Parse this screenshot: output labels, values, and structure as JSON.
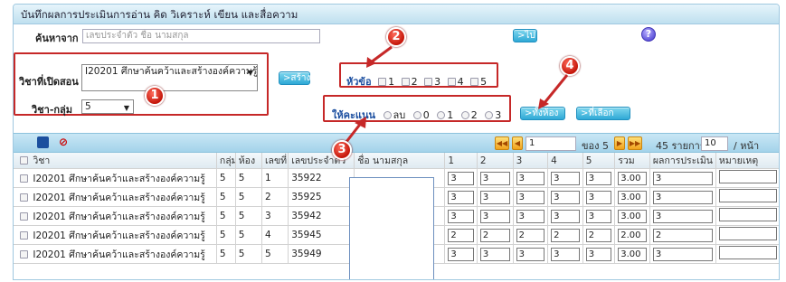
{
  "panel_title": "บันทึกผลการประเมินการอ่าน คิด วิเคราะห์ เขียน และสื่อความ",
  "search": {
    "label": "ค้นหาจาก",
    "placeholder": "เลขประจำตัว ชื่อ นามสกุล",
    "go_button": "ไป"
  },
  "subject": {
    "label": "วิชาที่เปิดสอน",
    "value": "I20201 ศึกษาค้นคว้าและสร้างองค์ความรู้"
  },
  "class_group": {
    "label": "วิชา-กลุ่ม",
    "value": "5"
  },
  "create_button": "สร้าง",
  "topics": {
    "label": "หัวข้อ",
    "options": [
      "1",
      "2",
      "3",
      "4",
      "5"
    ]
  },
  "scoring": {
    "label": "ให้คะแนน",
    "options": [
      "ลบ",
      "0",
      "1",
      "2",
      "3"
    ]
  },
  "room_button": "ทั้งห้อง",
  "selected_button": "ที่เลือก",
  "badges": {
    "b1": "1",
    "b2": "2",
    "b3": "3",
    "b4": "4"
  },
  "help_label": "?",
  "pager": {
    "page": "1",
    "of_label": "ของ 5",
    "total_label": "45 รายการ",
    "per_page": "10",
    "per_page_suffix": "/ หน้า"
  },
  "table": {
    "headers": [
      "วิชา",
      "กลุ่ม",
      "ห้อง",
      "เลขที่",
      "เลขประจำตัว",
      "ชื่อ นามสกุล",
      "1",
      "2",
      "3",
      "4",
      "5",
      "รวม",
      "ผลการประเมิน",
      "หมายเหตุ"
    ],
    "rows": [
      {
        "subject": "I20201 ศึกษาค้นคว้าและสร้างองค์ความรู้",
        "group": "5",
        "room": "5",
        "no": "1",
        "id": "35922",
        "s": [
          "3",
          "3",
          "3",
          "3",
          "3"
        ],
        "total": "3.00",
        "result": "3"
      },
      {
        "subject": "I20201 ศึกษาค้นคว้าและสร้างองค์ความรู้",
        "group": "5",
        "room": "5",
        "no": "2",
        "id": "35925",
        "s": [
          "3",
          "3",
          "3",
          "3",
          "3"
        ],
        "total": "3.00",
        "result": "3"
      },
      {
        "subject": "I20201 ศึกษาค้นคว้าและสร้างองค์ความรู้",
        "group": "5",
        "room": "5",
        "no": "3",
        "id": "35942",
        "s": [
          "3",
          "3",
          "3",
          "3",
          "3"
        ],
        "total": "3.00",
        "result": "3"
      },
      {
        "subject": "I20201 ศึกษาค้นคว้าและสร้างองค์ความรู้",
        "group": "5",
        "room": "5",
        "no": "4",
        "id": "35945",
        "s": [
          "2",
          "2",
          "2",
          "2",
          "2"
        ],
        "total": "2.00",
        "result": "2"
      },
      {
        "subject": "I20201 ศึกษาค้นคว้าและสร้างองค์ความรู้",
        "group": "5",
        "room": "5",
        "no": "5",
        "id": "35949",
        "s": [
          "3",
          "3",
          "3",
          "3",
          "3"
        ],
        "total": "3.00",
        "result": "3"
      }
    ]
  },
  "colors": {
    "accent": "#2fa9d6",
    "annotation": "#c62828",
    "header_bg": "#bfe0ef"
  }
}
